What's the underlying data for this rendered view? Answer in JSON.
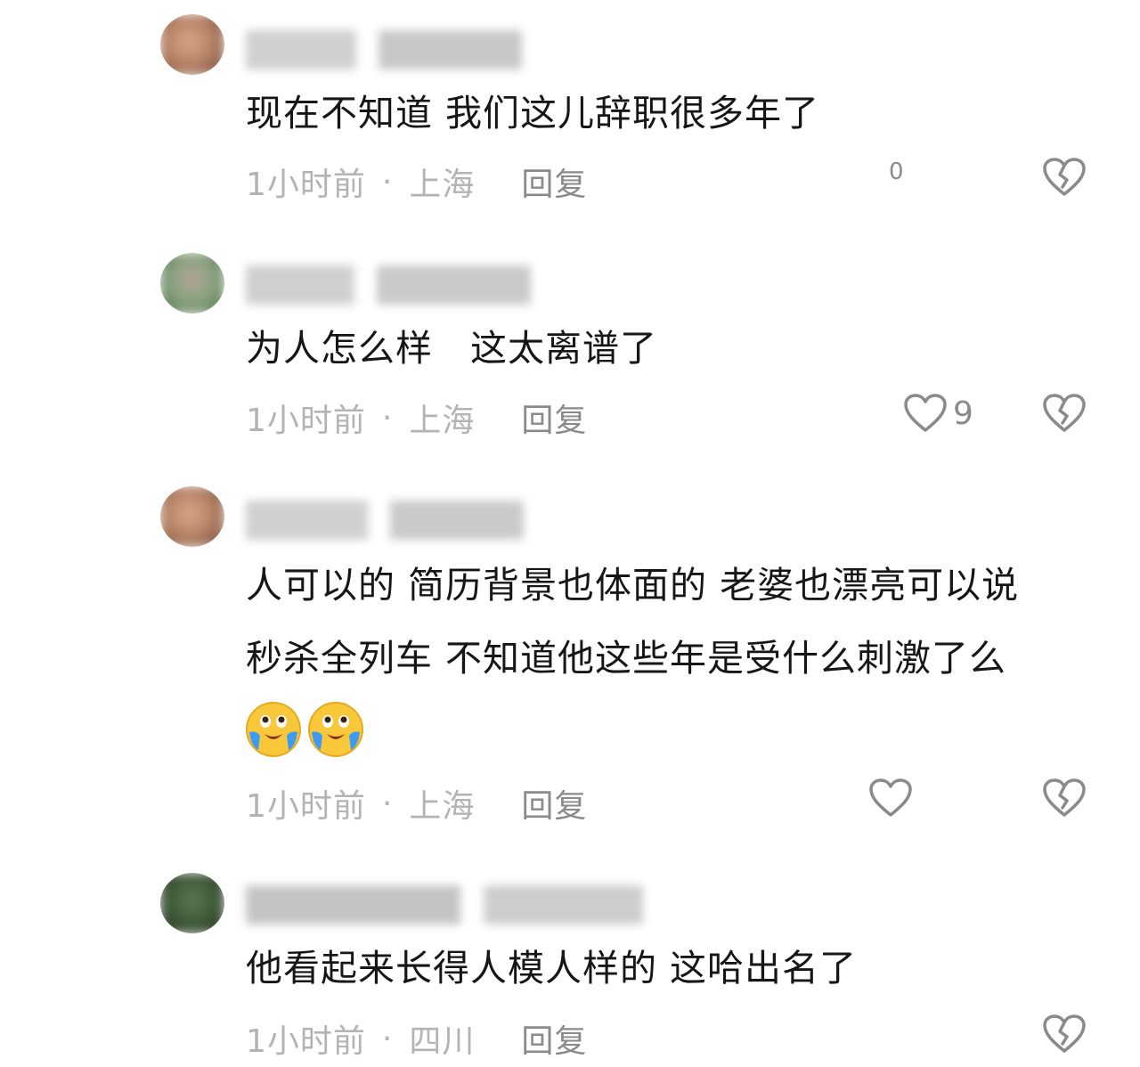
{
  "comments": [
    {
      "text_lines": [
        "现在不知道 我们这儿辞职很多年了"
      ],
      "time": "1小时前",
      "location": "上海",
      "reply": "回复",
      "like_count": "0"
    },
    {
      "text_lines": [
        "为人怎么样　这太离谱了"
      ],
      "time": "1小时前",
      "location": "上海",
      "reply": "回复",
      "like_count": "9"
    },
    {
      "text_lines": [
        "人可以的 简历背景也体面的 老婆也漂亮可以说",
        "秒杀全列车 不知道他这些年是受什么刺激了么"
      ],
      "emojis": [
        "crying-laugh-emoji",
        "crying-laugh-emoji"
      ],
      "time": "1小时前",
      "location": "上海",
      "reply": "回复"
    },
    {
      "text_lines": [
        "他看起来长得人模人样的 这哈出名了"
      ],
      "time": "1小时前",
      "location": "四川",
      "reply": "回复"
    }
  ],
  "icons": {
    "like": "heart-outline-icon",
    "dislike": "broken-heart-icon"
  },
  "colors": {
    "meta": "#b3b3b3",
    "reply": "#8a8a8a",
    "icon": "#8a8a8a"
  }
}
